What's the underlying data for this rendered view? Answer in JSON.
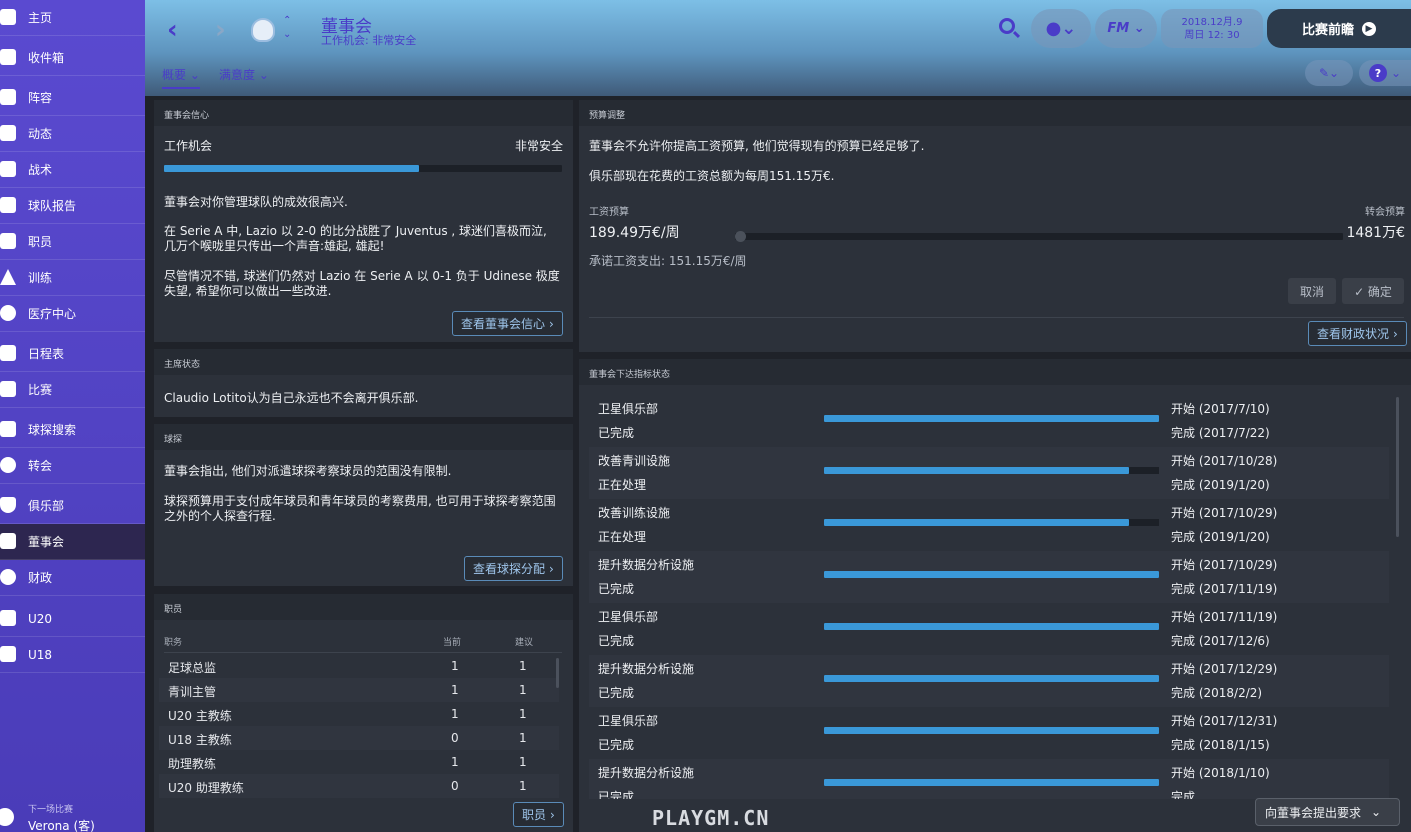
{
  "sidebar": {
    "items": [
      {
        "label": "主页",
        "icon": "home-icon"
      },
      {
        "label": "收件箱",
        "icon": "inbox-icon"
      },
      {
        "label": "阵容",
        "icon": "squad-icon"
      },
      {
        "label": "动态",
        "icon": "dynamics-icon"
      },
      {
        "label": "战术",
        "icon": "tactics-icon"
      },
      {
        "label": "球队报告",
        "icon": "team-report-icon"
      },
      {
        "label": "职员",
        "icon": "staff-icon"
      },
      {
        "label": "训练",
        "icon": "training-icon"
      },
      {
        "label": "医疗中心",
        "icon": "medical-cross-icon"
      },
      {
        "label": "日程表",
        "icon": "calendar-icon"
      },
      {
        "label": "比赛",
        "icon": "trophy-icon"
      },
      {
        "label": "球探搜索",
        "icon": "scout-search-icon"
      },
      {
        "label": "转会",
        "icon": "transfer-icon"
      },
      {
        "label": "俱乐部",
        "icon": "club-shield-icon"
      },
      {
        "label": "董事会",
        "icon": "board-icon"
      },
      {
        "label": "财政",
        "icon": "finance-pound-icon"
      },
      {
        "label": "U20",
        "icon": "u20-icon"
      },
      {
        "label": "U18",
        "icon": "u18-icon"
      }
    ],
    "next_match_label": "下一场比赛",
    "next_match_value": "Verona (客)"
  },
  "header": {
    "title": "董事会",
    "subtitle": "工作机会: 非常安全",
    "tabs": [
      "概要 ⌄",
      "满意度 ⌄"
    ],
    "date_line1": "2018.12月.9",
    "date_line2": "周日 12: 30",
    "fm_label": "FM ⌄",
    "continue_label": "比赛前瞻",
    "help_label": "?"
  },
  "confidence": {
    "title": "董事会信心",
    "job_label": "工作机会",
    "job_value": "非常安全",
    "job_level_percent": 64,
    "p1": "董事会对你管理球队的成效很高兴.",
    "p2": "在 Serie A 中, Lazio 以 2-0 的比分战胜了 Juventus , 球迷们喜极而泣, 几万个喉咙里只传出一个声音:雄起, 雄起!",
    "p3": "尽管情况不错, 球迷们仍然对 Lazio 在 Serie A 以 0-1 负于 Udinese 极度失望, 希望你可以做出一些改进.",
    "link": "查看董事会信心"
  },
  "chairman": {
    "title": "主席状态",
    "text": "Claudio Lotito认为自己永远也不会离开俱乐部."
  },
  "scouting": {
    "title": "球探",
    "p1": "董事会指出, 他们对派遣球探考察球员的范围没有限制.",
    "p2": "球探预算用于支付成年球员和青年球员的考察费用, 也可用于球探考察范围之外的个人探查行程.",
    "link": "查看球探分配"
  },
  "staff": {
    "title": "职员",
    "headers": [
      "职务",
      "当前",
      "建议"
    ],
    "rows": [
      {
        "role": "足球总监",
        "current": "1",
        "suggested": "1"
      },
      {
        "role": "青训主管",
        "current": "1",
        "suggested": "1"
      },
      {
        "role": "U20 主教练",
        "current": "1",
        "suggested": "1"
      },
      {
        "role": "U18 主教练",
        "current": "0",
        "suggested": "1"
      },
      {
        "role": "助理教练",
        "current": "1",
        "suggested": "1"
      },
      {
        "role": "U20 助理教练",
        "current": "0",
        "suggested": "1"
      }
    ],
    "link": "职员"
  },
  "budget": {
    "title": "预算调整",
    "p1": "董事会不允许你提高工资预算, 他们觉得现有的预算已经足够了.",
    "p2": "俱乐部现在花费的工资总额为每周151.15万€.",
    "wage_label": "工资预算",
    "wage_value": "189.49万€/周",
    "transfer_label": "转会预算",
    "transfer_value": "1481万€",
    "committed": "承诺工资支出: 151.15万€/周",
    "slider_fraction": 0,
    "cancel": "取消",
    "confirm": "✓ 确定",
    "link": "查看财政状况"
  },
  "objectives": {
    "title": "董事会下达指标状态",
    "rows": [
      {
        "name": "卫星俱乐部",
        "status": "已完成",
        "start": "开始 (2017/7/10)",
        "end": "完成 (2017/7/22)",
        "progress": 100
      },
      {
        "name": "改善青训设施",
        "status": "正在处理",
        "start": "开始 (2017/10/28)",
        "end": "完成 (2019/1/20)",
        "progress": 91
      },
      {
        "name": "改善训练设施",
        "status": "正在处理",
        "start": "开始 (2017/10/29)",
        "end": "完成 (2019/1/20)",
        "progress": 91
      },
      {
        "name": "提升数据分析设施",
        "status": "已完成",
        "start": "开始 (2017/10/29)",
        "end": "完成 (2017/11/19)",
        "progress": 100
      },
      {
        "name": "卫星俱乐部",
        "status": "已完成",
        "start": "开始 (2017/11/19)",
        "end": "完成 (2017/12/6)",
        "progress": 100
      },
      {
        "name": "提升数据分析设施",
        "status": "已完成",
        "start": "开始 (2017/12/29)",
        "end": "完成 (2018/2/2)",
        "progress": 100
      },
      {
        "name": "卫星俱乐部",
        "status": "已完成",
        "start": "开始 (2017/12/31)",
        "end": "完成 (2018/1/15)",
        "progress": 100
      },
      {
        "name": "提升数据分析设施",
        "status": "已完成",
        "start": "开始 (2018/1/10)",
        "end": "完成",
        "progress": 100
      }
    ],
    "request": "向董事会提出要求"
  },
  "watermark": "PLAYGM.CN",
  "colors": {
    "accent": "#4a3cc8",
    "bar": "#3a98d8",
    "sidebar": "#5247c8"
  }
}
